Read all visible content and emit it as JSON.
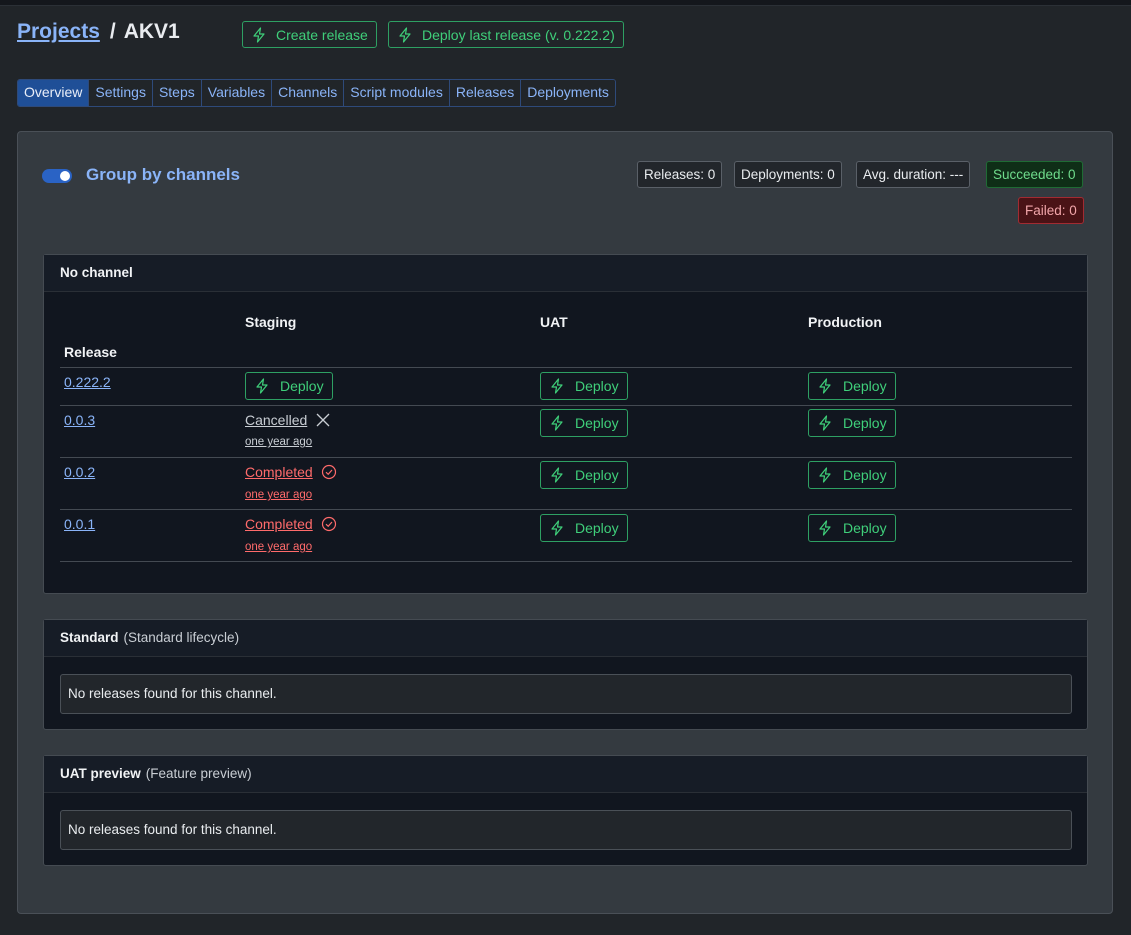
{
  "breadcrumb": {
    "root": "Projects",
    "separator": "/",
    "current": "AKV1"
  },
  "header_buttons": {
    "create_release": "Create release",
    "deploy_last": "Deploy last release (v. 0.222.2)"
  },
  "tabs": [
    "Overview",
    "Settings",
    "Steps",
    "Variables",
    "Channels",
    "Script modules",
    "Releases",
    "Deployments"
  ],
  "active_tab": "Overview",
  "group_toggle": {
    "label": "Group by channels",
    "on": true
  },
  "stats": {
    "releases": "Releases: 0",
    "deployments": "Deployments: 0",
    "avg_duration": "Avg. duration: ---",
    "succeeded": "Succeeded: 0",
    "failed": "Failed: 0"
  },
  "channels": [
    {
      "name": "No channel",
      "subtitle": "",
      "columns": {
        "release": "Release",
        "environments": [
          "Staging",
          "UAT",
          "Production"
        ]
      },
      "rows": [
        {
          "release": "0.222.2",
          "staging": {
            "type": "deploy",
            "label": "Deploy"
          },
          "uat": "Deploy",
          "production": "Deploy"
        },
        {
          "release": "0.0.3",
          "staging": {
            "type": "status",
            "label": "Cancelled",
            "icon": "x-icon",
            "time": "one year ago"
          },
          "uat": "Deploy",
          "production": "Deploy"
        },
        {
          "release": "0.0.2",
          "staging": {
            "type": "status",
            "label": "Completed",
            "icon": "check-circle-icon",
            "time": "one year ago"
          },
          "uat": "Deploy",
          "production": "Deploy"
        },
        {
          "release": "0.0.1",
          "staging": {
            "type": "status",
            "label": "Completed",
            "icon": "check-circle-icon",
            "time": "one year ago"
          },
          "uat": "Deploy",
          "production": "Deploy"
        }
      ]
    },
    {
      "name": "Standard",
      "subtitle": "(Standard lifecycle)",
      "empty_message": "No releases found for this channel."
    },
    {
      "name": "UAT preview",
      "subtitle": "(Feature preview)",
      "empty_message": "No releases found for this channel."
    }
  ],
  "colors": {
    "background": "#212529",
    "card": "#343a40",
    "link": "#8ab4f8",
    "deploy": "#3fcf7a",
    "active_tab": "#1f4f97",
    "completed": "#ff6b6b",
    "succeeded_bg": "#0f2e17",
    "failed_bg": "#4a1316"
  }
}
